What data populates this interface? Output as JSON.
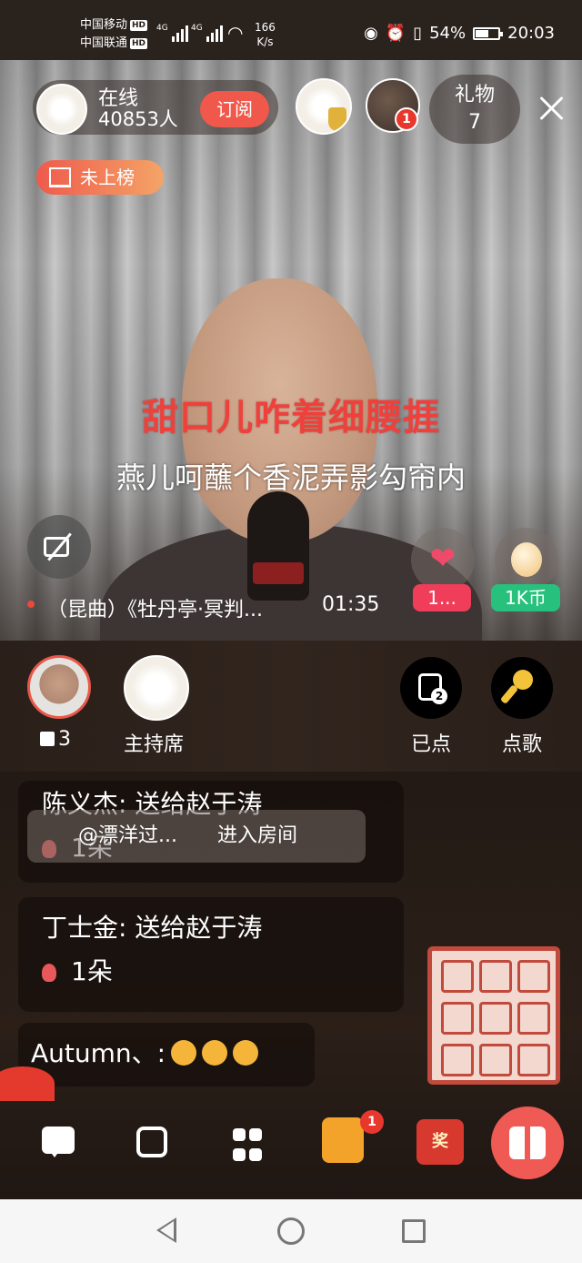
{
  "status_bar": {
    "carrier1": "中国移动",
    "carrier2": "中国联通",
    "hd_label": "HD",
    "net_type": "4G",
    "net_speed": "166",
    "net_unit": "K/s",
    "battery": "54%",
    "time": "20:03"
  },
  "header": {
    "online_label": "在线",
    "online_count": "40853人",
    "subscribe_label": "订阅",
    "fan_badge_count": "1",
    "gift_label": "礼物",
    "gift_count": "7",
    "rank_label": "未上榜"
  },
  "lyrics": {
    "line1": "甜口儿咋着细腰捱",
    "line2": "燕儿呵蘸个香泥弄影勾帘内"
  },
  "player": {
    "song_title": "（昆曲）《牡丹亭·冥判...",
    "time": "01:35",
    "like_count": "1...",
    "coin_count": "1K币"
  },
  "seats": {
    "gift_count": "3",
    "host_seat_label": "主持席",
    "ordered_label": "已点",
    "ordered_badge": "2",
    "order_song_label": "点歌"
  },
  "chat": {
    "messages": [
      {
        "user": "陈义杰",
        "text": ": 送给赵于涛",
        "gift": "1朵"
      },
      {
        "user": "丁士金",
        "text": ": 送给赵于涛",
        "gift": "1朵"
      },
      {
        "user": "Autumn、",
        "text": ":"
      }
    ],
    "enter_user": "@漂洋过...",
    "enter_text": "进入房间"
  },
  "toolbar": {
    "task_badge": "1",
    "lottery_label": "奖"
  },
  "colors": {
    "accent": "#f0584b",
    "lyric_red": "#f0403c",
    "like_pink": "#f03d5a",
    "coin_green": "#27c07c"
  }
}
